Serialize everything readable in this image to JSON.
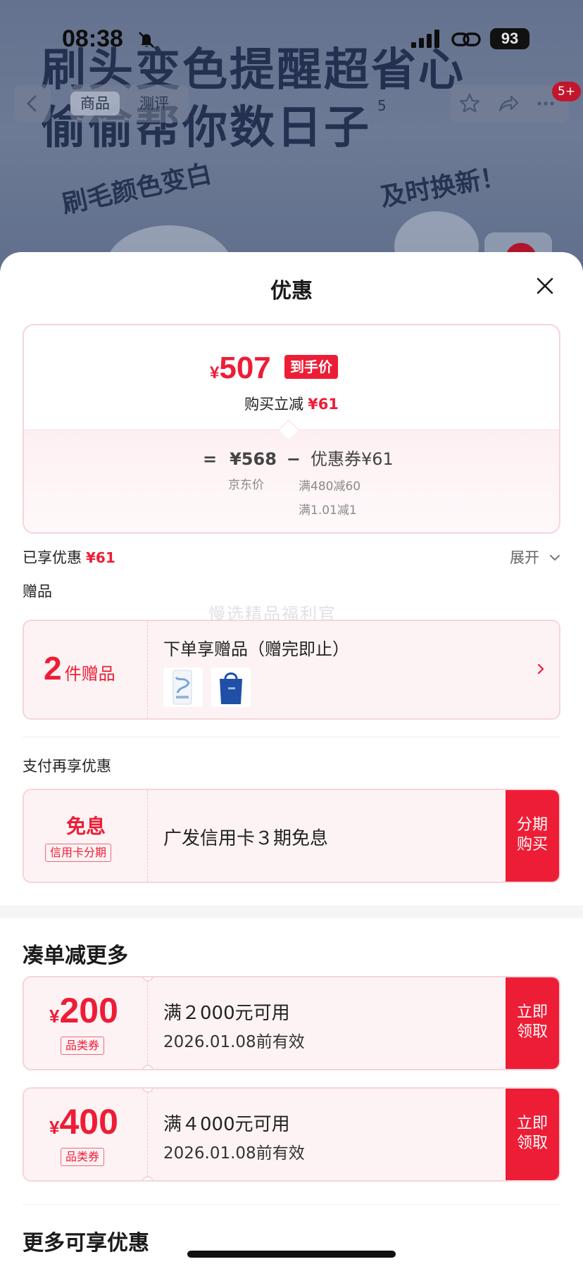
{
  "status_bar": {
    "time": "08:38",
    "battery": "93"
  },
  "background_page": {
    "headline_1": "刷头变色提醒超省心",
    "headline_2": "偷偷帮你数日子",
    "superscript": "5",
    "arc_text_1": "刷毛颜色变白",
    "arc_text_2": "及时换新！",
    "tabs": [
      "商品",
      "测评"
    ],
    "badge": "5+"
  },
  "sheet": {
    "title": "优惠",
    "final_price": {
      "currency": "¥",
      "amount": "507",
      "tag": "到手价"
    },
    "instant_discount": {
      "label": "购买立减",
      "amount": "¥61"
    },
    "formula": {
      "equals": "=",
      "jd_price": "¥568",
      "minus": "−",
      "coupon": "优惠券¥61",
      "jd_price_label": "京东价",
      "coupon_rule_1": "满480减60",
      "coupon_rule_2": "满1.01减1"
    },
    "enjoyed": {
      "label": "已享优惠",
      "amount": "¥61"
    },
    "expand_label": "展开",
    "gift_section": {
      "label": "赠品",
      "count": "2",
      "count_unit": "件赠品",
      "title": "下单享赠品（赠完即止）"
    },
    "watermark": "慢选精品福利官",
    "pay_section": {
      "label": "支付再享优惠",
      "main": "免息",
      "tag": "信用卡分期",
      "text": "广发信用卡３期免息",
      "button": [
        "分期",
        "购买"
      ]
    },
    "bundle_section": {
      "title": "凑单减更多",
      "coupons": [
        {
          "currency": "¥",
          "amount": "200",
          "tag": "品类券",
          "condition": "满２000元可用",
          "expiry": "2026.01.08前有效",
          "button": [
            "立即",
            "领取"
          ]
        },
        {
          "currency": "¥",
          "amount": "400",
          "tag": "品类券",
          "condition": "满４000元可用",
          "expiry": "2026.01.08前有效",
          "button": [
            "立即",
            "领取"
          ]
        }
      ]
    },
    "more_section": {
      "title": "更多可享优惠"
    }
  },
  "colors": {
    "accent": "#ee1d36",
    "card_border": "#f6d5da",
    "card_bg": "#fdf3f4"
  },
  "icons": [
    "bell-slash-icon",
    "signal-icon",
    "link-icon",
    "back-arrow-icon",
    "star-icon",
    "share-icon",
    "more-icon",
    "close-icon",
    "chevron-down-icon",
    "chevron-right-icon"
  ]
}
